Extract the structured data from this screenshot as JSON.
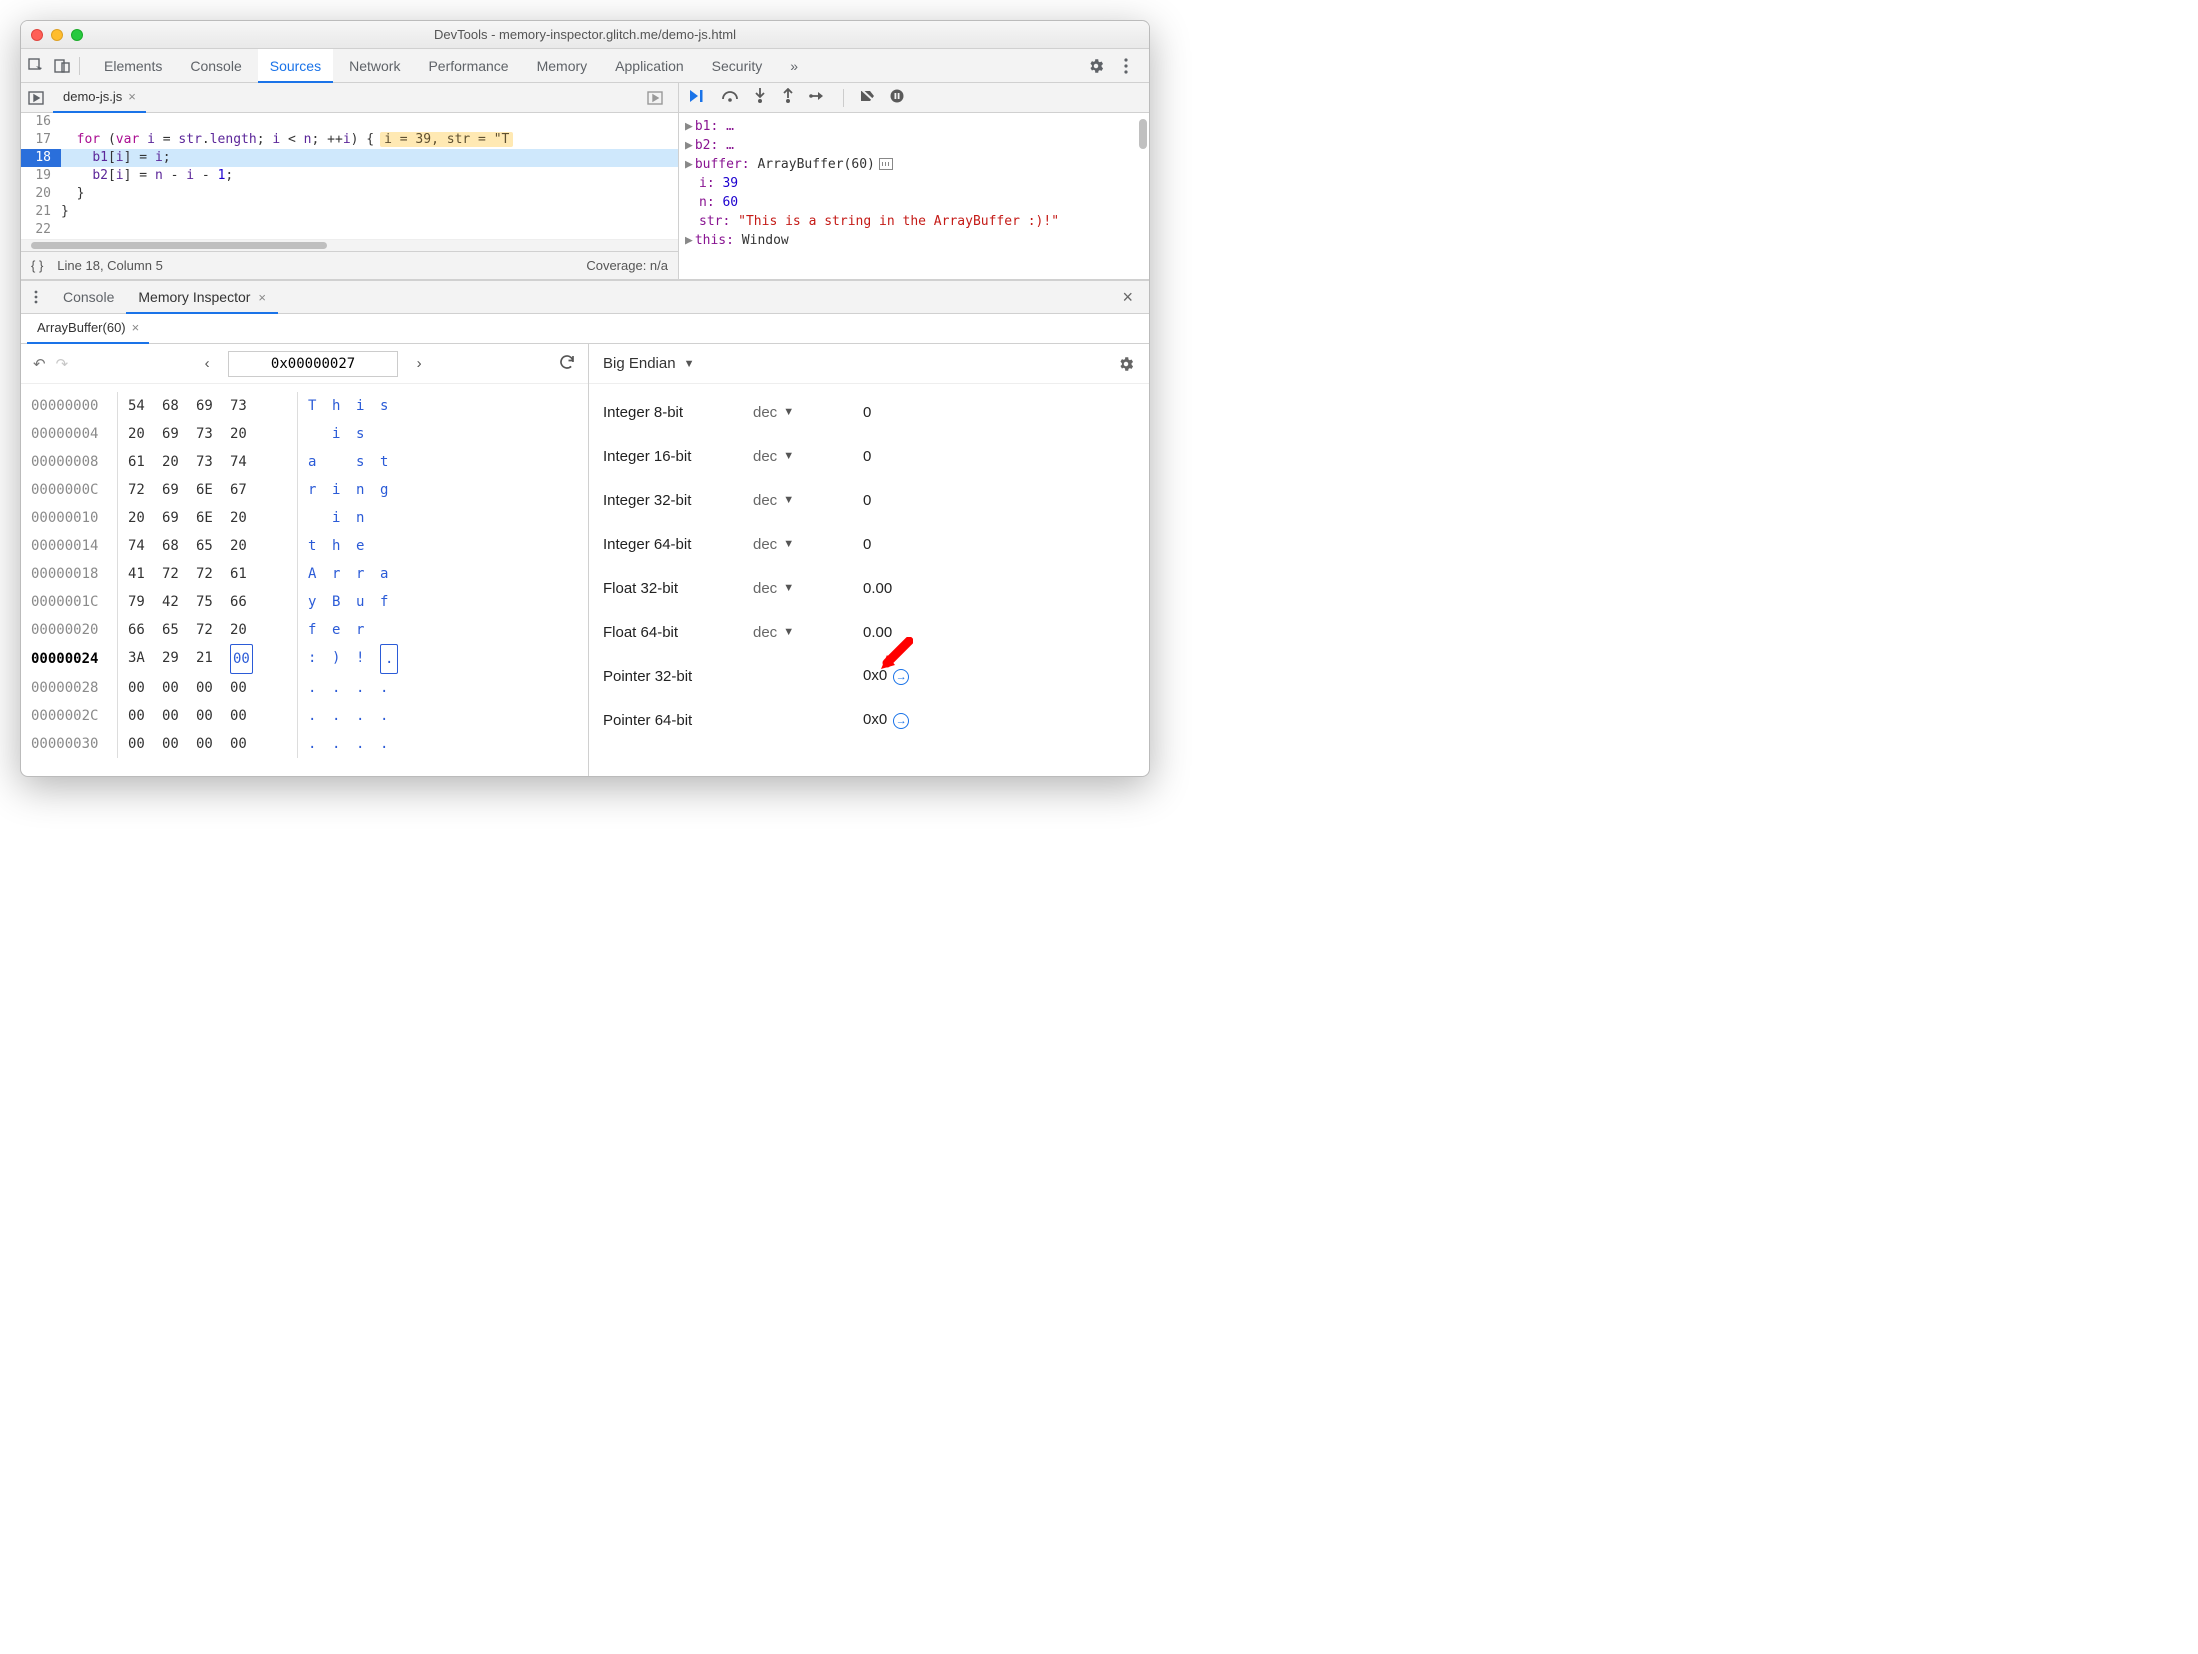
{
  "window": {
    "title": "DevTools - memory-inspector.glitch.me/demo-js.html"
  },
  "panels": {
    "tabs": [
      "Elements",
      "Console",
      "Sources",
      "Network",
      "Performance",
      "Memory",
      "Application",
      "Security"
    ],
    "active": "Sources"
  },
  "file": {
    "name": "demo-js.js"
  },
  "code": {
    "lines": [
      {
        "n": "16",
        "t": " "
      },
      {
        "n": "17",
        "t": "  for (var i = str.length; i < n; ++i) {"
      },
      {
        "n": "18",
        "t": "    b1[i] = i;",
        "hl": true
      },
      {
        "n": "19",
        "t": "    b2[i] = n - i - 1;"
      },
      {
        "n": "20",
        "t": "  }"
      },
      {
        "n": "21",
        "t": "}"
      },
      {
        "n": "22",
        "t": " "
      }
    ],
    "inline_eval": "i = 39, str = \"T"
  },
  "status": {
    "brace": "{ }",
    "pos": "Line 18, Column 5",
    "coverage": "Coverage: n/a"
  },
  "scope": {
    "b1": "b1: …",
    "b2": "b2: …",
    "buffer_k": "buffer:",
    "buffer_v": "ArrayBuffer(60)",
    "i_k": "i:",
    "i_v": "39",
    "n_k": "n:",
    "n_v": "60",
    "str_k": "str:",
    "str_v": "\"This is a string in the ArrayBuffer :)!\"",
    "this_k": "this:",
    "this_v": "Window"
  },
  "drawer": {
    "tabs": [
      "Console",
      "Memory Inspector"
    ],
    "active": "Memory Inspector"
  },
  "mi": {
    "tab": "ArrayBuffer(60)",
    "address": "0x00000027",
    "rows": [
      {
        "a": "00000000",
        "b": [
          "54",
          "68",
          "69",
          "73"
        ],
        "c": [
          "T",
          "h",
          "i",
          "s"
        ]
      },
      {
        "a": "00000004",
        "b": [
          "20",
          "69",
          "73",
          "20"
        ],
        "c": [
          " ",
          "i",
          "s",
          " "
        ]
      },
      {
        "a": "00000008",
        "b": [
          "61",
          "20",
          "73",
          "74"
        ],
        "c": [
          "a",
          " ",
          "s",
          "t"
        ]
      },
      {
        "a": "0000000C",
        "b": [
          "72",
          "69",
          "6E",
          "67"
        ],
        "c": [
          "r",
          "i",
          "n",
          "g"
        ]
      },
      {
        "a": "00000010",
        "b": [
          "20",
          "69",
          "6E",
          "20"
        ],
        "c": [
          " ",
          "i",
          "n",
          " "
        ]
      },
      {
        "a": "00000014",
        "b": [
          "74",
          "68",
          "65",
          "20"
        ],
        "c": [
          "t",
          "h",
          "e",
          " "
        ]
      },
      {
        "a": "00000018",
        "b": [
          "41",
          "72",
          "72",
          "61"
        ],
        "c": [
          "A",
          "r",
          "r",
          "a"
        ]
      },
      {
        "a": "0000001C",
        "b": [
          "79",
          "42",
          "75",
          "66"
        ],
        "c": [
          "y",
          "B",
          "u",
          "f"
        ]
      },
      {
        "a": "00000020",
        "b": [
          "66",
          "65",
          "72",
          "20"
        ],
        "c": [
          "f",
          "e",
          "r",
          " "
        ]
      },
      {
        "a": "00000024",
        "b": [
          "3A",
          "29",
          "21",
          "00"
        ],
        "c": [
          ":",
          ")",
          "!",
          "."
        ],
        "bold": true,
        "sel": 3
      },
      {
        "a": "00000028",
        "b": [
          "00",
          "00",
          "00",
          "00"
        ],
        "c": [
          ".",
          ".",
          ".",
          "."
        ]
      },
      {
        "a": "0000002C",
        "b": [
          "00",
          "00",
          "00",
          "00"
        ],
        "c": [
          ".",
          ".",
          ".",
          "."
        ]
      },
      {
        "a": "00000030",
        "b": [
          "00",
          "00",
          "00",
          "00"
        ],
        "c": [
          ".",
          ".",
          ".",
          "."
        ]
      }
    ],
    "endian": "Big Endian",
    "values": [
      {
        "label": "Integer 8-bit",
        "fmt": "dec",
        "val": "0"
      },
      {
        "label": "Integer 16-bit",
        "fmt": "dec",
        "val": "0"
      },
      {
        "label": "Integer 32-bit",
        "fmt": "dec",
        "val": "0"
      },
      {
        "label": "Integer 64-bit",
        "fmt": "dec",
        "val": "0"
      },
      {
        "label": "Float 32-bit",
        "fmt": "dec",
        "val": "0.00"
      },
      {
        "label": "Float 64-bit",
        "fmt": "dec",
        "val": "0.00"
      },
      {
        "label": "Pointer 32-bit",
        "fmt": "",
        "val": "0x0",
        "jump": true,
        "arrow": true
      },
      {
        "label": "Pointer 64-bit",
        "fmt": "",
        "val": "0x0",
        "jump": true
      }
    ]
  }
}
